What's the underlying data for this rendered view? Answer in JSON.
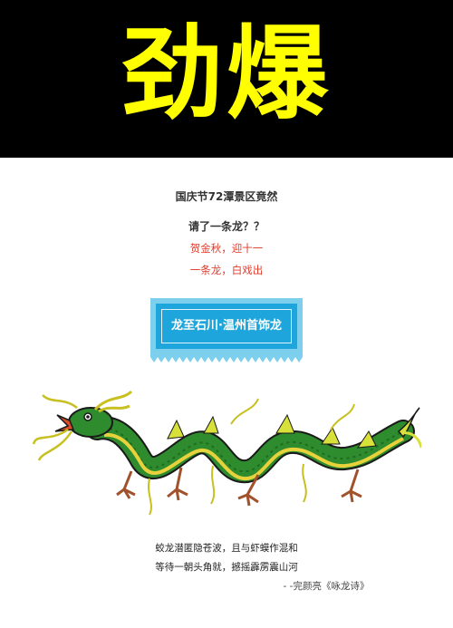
{
  "banner": {
    "title": "劲爆",
    "text_color": "#ffff00",
    "background": "#000000"
  },
  "headline": {
    "line1": "国庆节72潭景区竟然",
    "line2": "请了一条龙？？"
  },
  "subtitle": {
    "line1": "贺金秋，迎十一",
    "line2": "一条龙，白戏出",
    "color": "#e03a2a"
  },
  "badge": {
    "label": "龙至石川·温州首饰龙",
    "color": "#1ea5dc"
  },
  "illustration": {
    "subject": "green Chinese dragon",
    "icon": "dragon-illustration"
  },
  "poem": {
    "line1": "蛟龙潜匿隐苍波，且与虾蟆作混和",
    "line2": "等待一朝头角就，撼摇霹雳震山河",
    "attribution": "- -完颜亮《咏龙诗》"
  }
}
